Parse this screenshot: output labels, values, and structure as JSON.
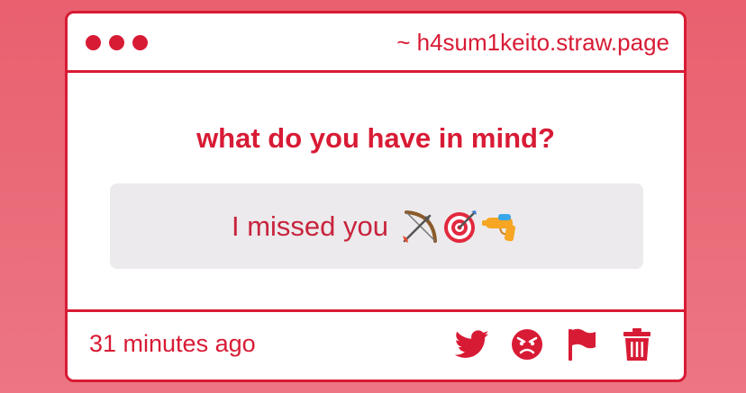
{
  "window": {
    "url": "~ h4sum1keito.straw.page"
  },
  "question": {
    "text": "what do you have in mind?"
  },
  "answer": {
    "text": "I missed you",
    "emojis": [
      "bow-and-arrow-icon",
      "direct-hit-target-icon",
      "water-pistol-icon"
    ]
  },
  "footer": {
    "timestamp": "31 minutes ago",
    "actions": [
      "twitter-share",
      "angry-react",
      "report-flag",
      "delete"
    ]
  },
  "colors": {
    "accent": "#d81b35",
    "background_top": "#e9606f",
    "answer_bg": "#eceaec"
  }
}
